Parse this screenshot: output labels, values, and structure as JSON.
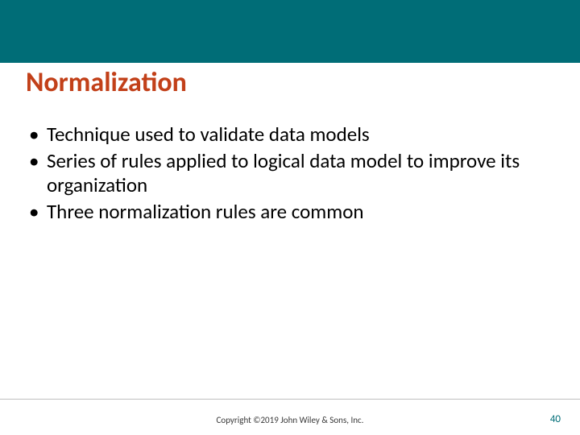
{
  "colors": {
    "accent": "#006d77",
    "title": "#c24019"
  },
  "slide": {
    "title": "Normalization",
    "bullets": [
      "Technique used to validate data models",
      "Series of rules applied to logical data model to improve its organization",
      "Three normalization rules are common"
    ],
    "copyright": "Copyright ©2019 John Wiley & Sons, Inc.",
    "page_number": "40"
  }
}
